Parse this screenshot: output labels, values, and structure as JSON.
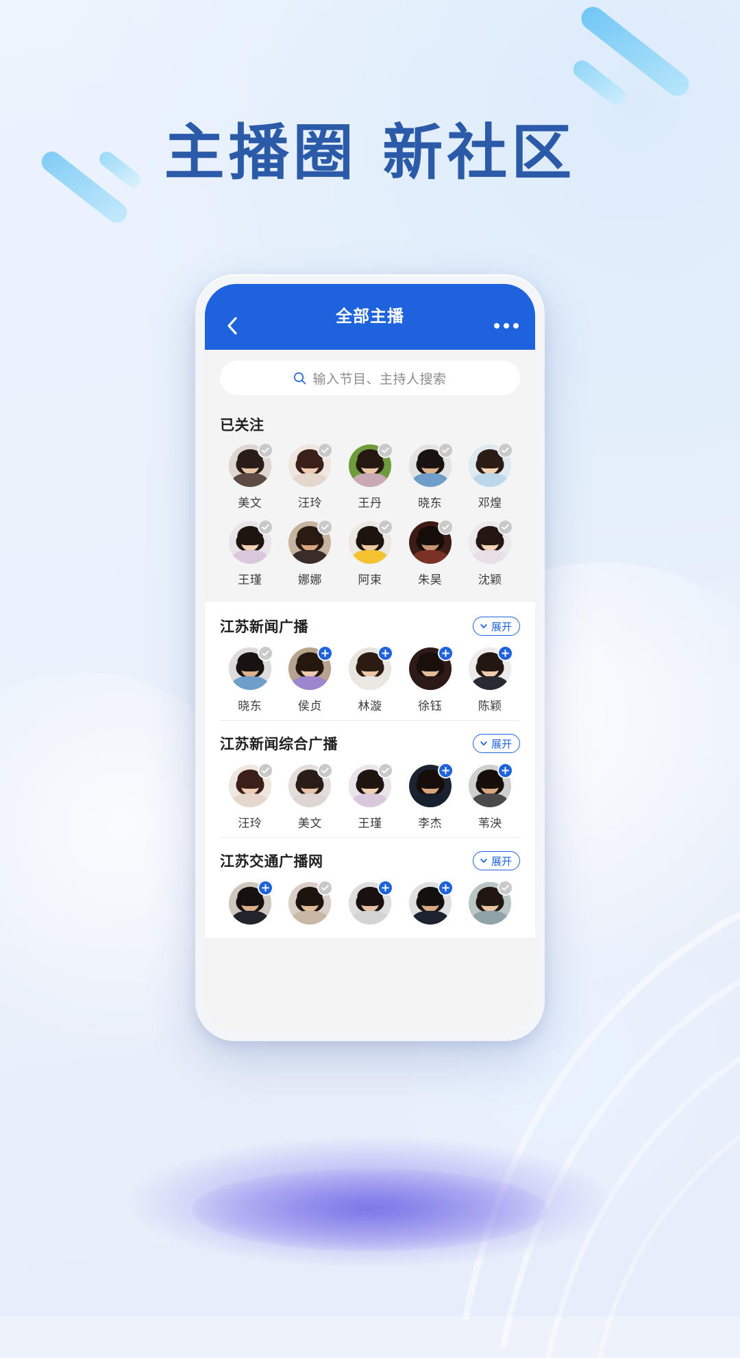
{
  "poster": {
    "headline": "主播圈 新社区",
    "accent_color": "#2b5aa8",
    "brand_blue": "#1e63dd",
    "background_color": "#eef3fb"
  },
  "navbar": {
    "title": "全部主播",
    "back_icon": "chevron-left-icon",
    "more_icon": "ellipsis-icon"
  },
  "search": {
    "placeholder": "输入节目、主持人搜索",
    "icon": "search-icon",
    "value": ""
  },
  "followed": {
    "title": "已关注",
    "people": [
      {
        "name": "美文",
        "followed": true,
        "skin": "#e8c3a8",
        "hair": "#2a1d18",
        "cloth": "#5c4a43",
        "bg": "#ddd6d2"
      },
      {
        "name": "汪玲",
        "followed": true,
        "skin": "#f0cdb0",
        "hair": "#3a2018",
        "cloth": "#e6d7cd",
        "bg": "#efe6df"
      },
      {
        "name": "王丹",
        "followed": true,
        "skin": "#e9c6a6",
        "hair": "#241810",
        "cloth": "#caa9b5",
        "bg": "#6e9c3c"
      },
      {
        "name": "晓东",
        "followed": true,
        "skin": "#dcb18c",
        "hair": "#181310",
        "cloth": "#6e9ec9",
        "bg": "#e3e3e3"
      },
      {
        "name": "邓煌",
        "followed": true,
        "skin": "#f2d3b6",
        "hair": "#2b1c15",
        "cloth": "#bcd7ea",
        "bg": "#dfe9f0"
      },
      {
        "name": "王瑾",
        "followed": true,
        "skin": "#f0cfb3",
        "hair": "#1e1510",
        "cloth": "#d9c8dc",
        "bg": "#e9e4ea"
      },
      {
        "name": "娜娜",
        "followed": true,
        "skin": "#d9a880",
        "hair": "#2a1a12",
        "cloth": "#3a2c26",
        "bg": "#c6b49f"
      },
      {
        "name": "阿束",
        "followed": true,
        "skin": "#eec7a3",
        "hair": "#1d140f",
        "cloth": "#f2c230",
        "bg": "#ece7e0"
      },
      {
        "name": "朱昊",
        "followed": true,
        "skin": "#c99571",
        "hair": "#140d09",
        "cloth": "#7a3226",
        "bg": "#3c1c15"
      },
      {
        "name": "沈颖",
        "followed": true,
        "skin": "#f3d4b8",
        "hair": "#241711",
        "cloth": "#e9dfe6",
        "bg": "#ece9ec"
      }
    ]
  },
  "stations": [
    {
      "name": "江苏新闻广播",
      "expand_label": "展开",
      "expand_icon": "chevron-down-icon",
      "people": [
        {
          "name": "晓东",
          "followed": true,
          "skin": "#dcb18c",
          "hair": "#181310",
          "cloth": "#6e9ec9",
          "bg": "#dcdcdc"
        },
        {
          "name": "侯贞",
          "followed": false,
          "skin": "#eec9ad",
          "hair": "#241811",
          "cloth": "#9e86cf",
          "bg": "#b7a38e"
        },
        {
          "name": "林漩",
          "followed": false,
          "skin": "#edc7a8",
          "hair": "#2b1b12",
          "cloth": "#ebe7e2",
          "bg": "#e8e4df"
        },
        {
          "name": "徐钰",
          "followed": false,
          "skin": "#e6bb98",
          "hair": "#1a100b",
          "cloth": "#2b1a18",
          "bg": "#2e1b18"
        },
        {
          "name": "陈颖",
          "followed": false,
          "skin": "#efccae",
          "hair": "#231711",
          "cloth": "#2a2a32",
          "bg": "#eceaea"
        }
      ]
    },
    {
      "name": "江苏新闻综合广播",
      "expand_label": "展开",
      "expand_icon": "chevron-down-icon",
      "people": [
        {
          "name": "汪玲",
          "followed": true,
          "skin": "#f0cdb0",
          "hair": "#3a2018",
          "cloth": "#e6d7cd",
          "bg": "#efe6df"
        },
        {
          "name": "美文",
          "followed": true,
          "skin": "#e8c3a8",
          "hair": "#2a1d18",
          "cloth": "#ddd6d2",
          "bg": "#e3dedb"
        },
        {
          "name": "王瑾",
          "followed": true,
          "skin": "#f0cfb3",
          "hair": "#1e1510",
          "cloth": "#d9c8dc",
          "bg": "#e9e4ea"
        },
        {
          "name": "李杰",
          "followed": false,
          "skin": "#d8a37c",
          "hair": "#140d09",
          "cloth": "#17202e",
          "bg": "#1b2230"
        },
        {
          "name": "苇泱",
          "followed": false,
          "skin": "#d7a57f",
          "hair": "#150e0a",
          "cloth": "#4a4a4a",
          "bg": "#cfcfcf"
        }
      ]
    },
    {
      "name": "江苏交通广播网",
      "expand_label": "展开",
      "expand_icon": "chevron-down-icon",
      "people": [
        {
          "name": "",
          "followed": false,
          "skin": "#dcae87",
          "hair": "#161010",
          "cloth": "#22242c",
          "bg": "#cfc6bd"
        },
        {
          "name": "",
          "followed": true,
          "skin": "#e5bc98",
          "hair": "#1d1410",
          "cloth": "#c9b7a5",
          "bg": "#d9cfc6"
        },
        {
          "name": "",
          "followed": false,
          "skin": "#e6c0a0",
          "hair": "#181110",
          "cloth": "#d4d4d4",
          "bg": "#dedede"
        },
        {
          "name": "",
          "followed": false,
          "skin": "#d7a981",
          "hair": "#131010",
          "cloth": "#1d2430",
          "bg": "#e0e0e0"
        },
        {
          "name": "",
          "followed": true,
          "skin": "#e8c5a5",
          "hair": "#221710",
          "cloth": "#8fa3a8",
          "bg": "#b9c6c3"
        }
      ]
    }
  ]
}
